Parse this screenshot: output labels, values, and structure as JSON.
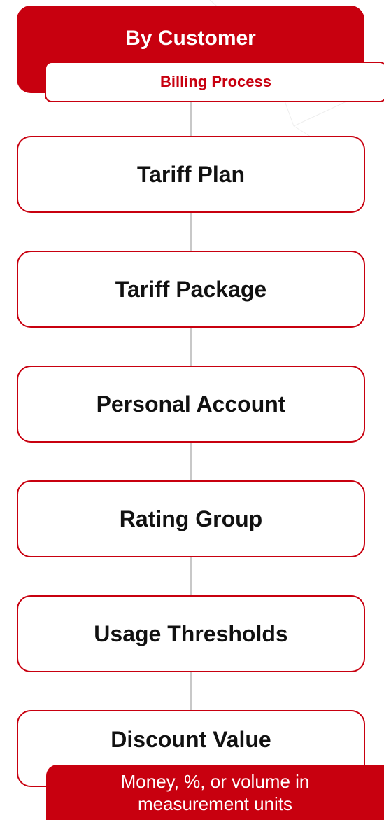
{
  "header": {
    "title": "By Customer",
    "subtitle": "Billing Process"
  },
  "steps": [
    {
      "label": "Tariff Plan"
    },
    {
      "label": "Tariff Package"
    },
    {
      "label": "Personal Account"
    },
    {
      "label": "Rating Group"
    },
    {
      "label": "Usage Thresholds"
    },
    {
      "label": "Discount Value"
    }
  ],
  "note": {
    "line1": "Money, %, or volume in",
    "line2": "measurement units"
  },
  "colors": {
    "accent": "#c8000f",
    "text": "#111111",
    "connector": "#c8c8c8",
    "background": "#ffffff"
  }
}
